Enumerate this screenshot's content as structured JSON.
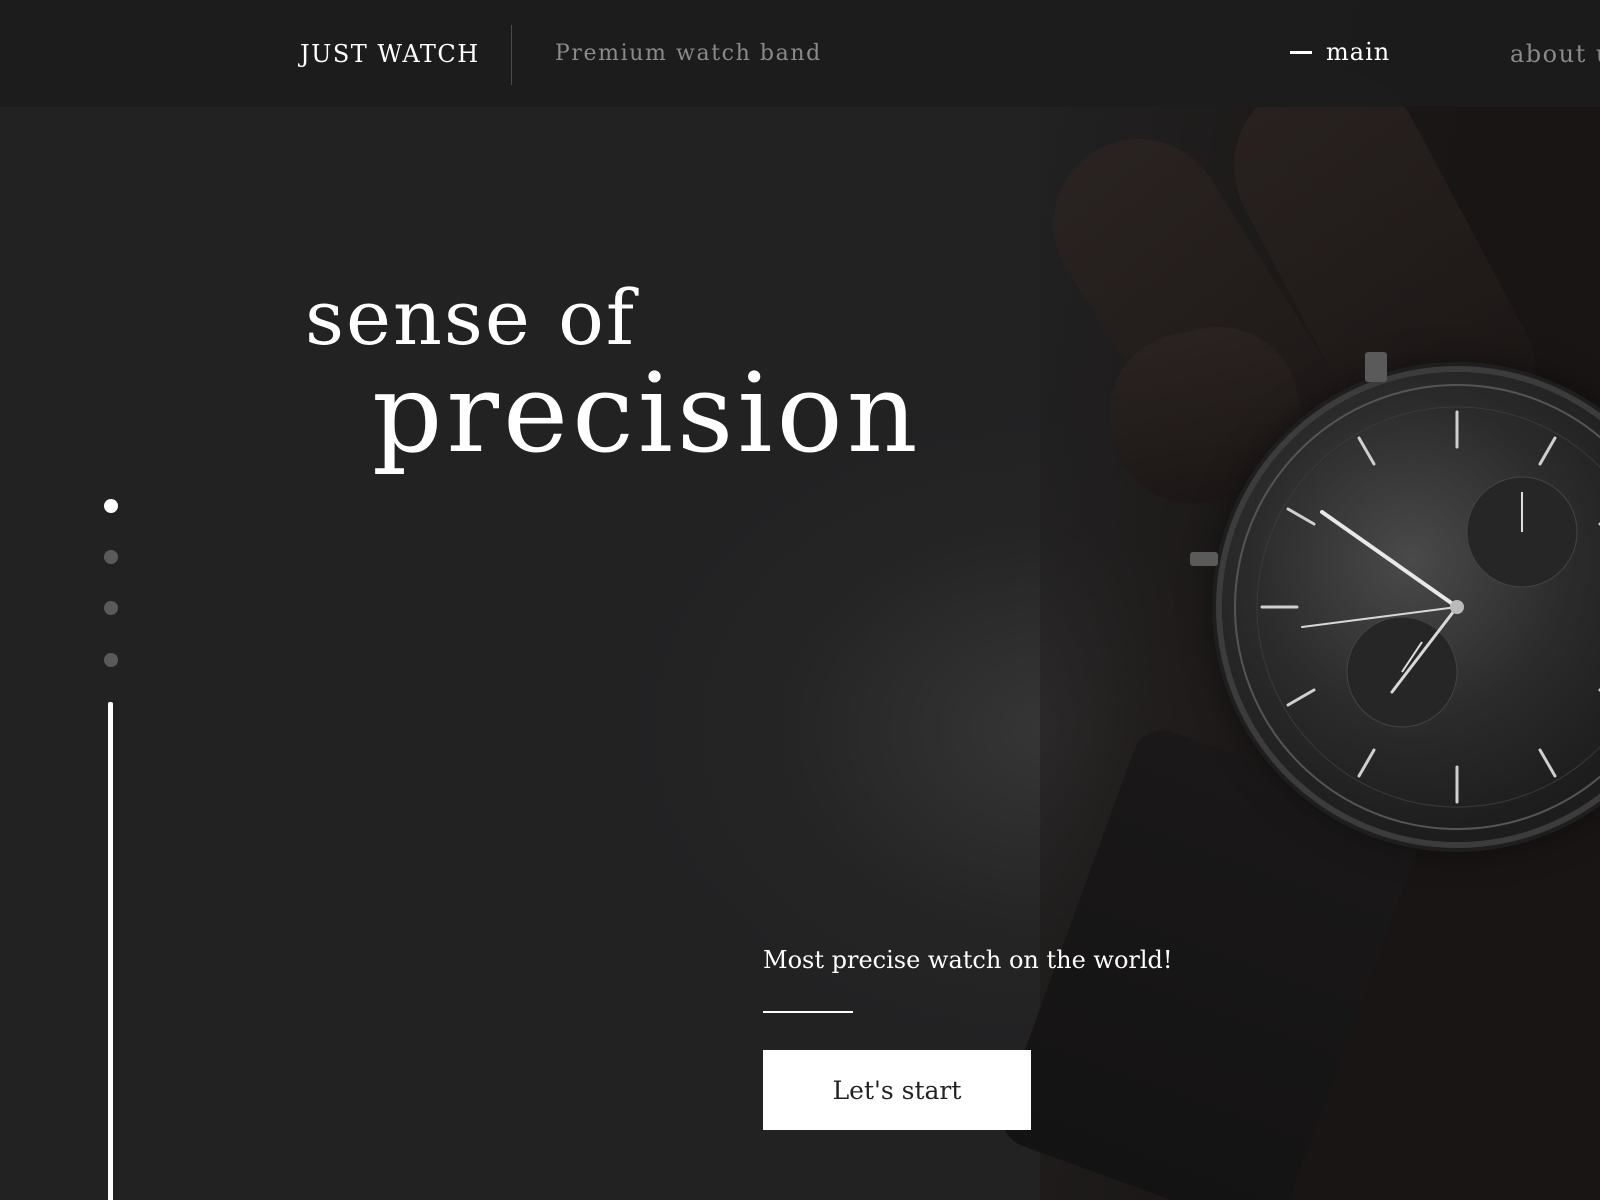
{
  "header": {
    "logo": "JUST WATCH",
    "tagline": "Premium watch band",
    "nav": [
      {
        "label": "main",
        "active": true
      },
      {
        "label": "about u",
        "active": false
      }
    ]
  },
  "hero": {
    "line1": "sense of",
    "line2": "precision"
  },
  "slider": {
    "total_slides": 4,
    "active_index": 0
  },
  "cta": {
    "text": "Most precise watch on the world!",
    "button_label": "Let's start"
  },
  "colors": {
    "background": "#222223",
    "accent": "#ffffff",
    "muted_text": "#8a8a8a",
    "inactive_dot": "#5a5a5a"
  }
}
